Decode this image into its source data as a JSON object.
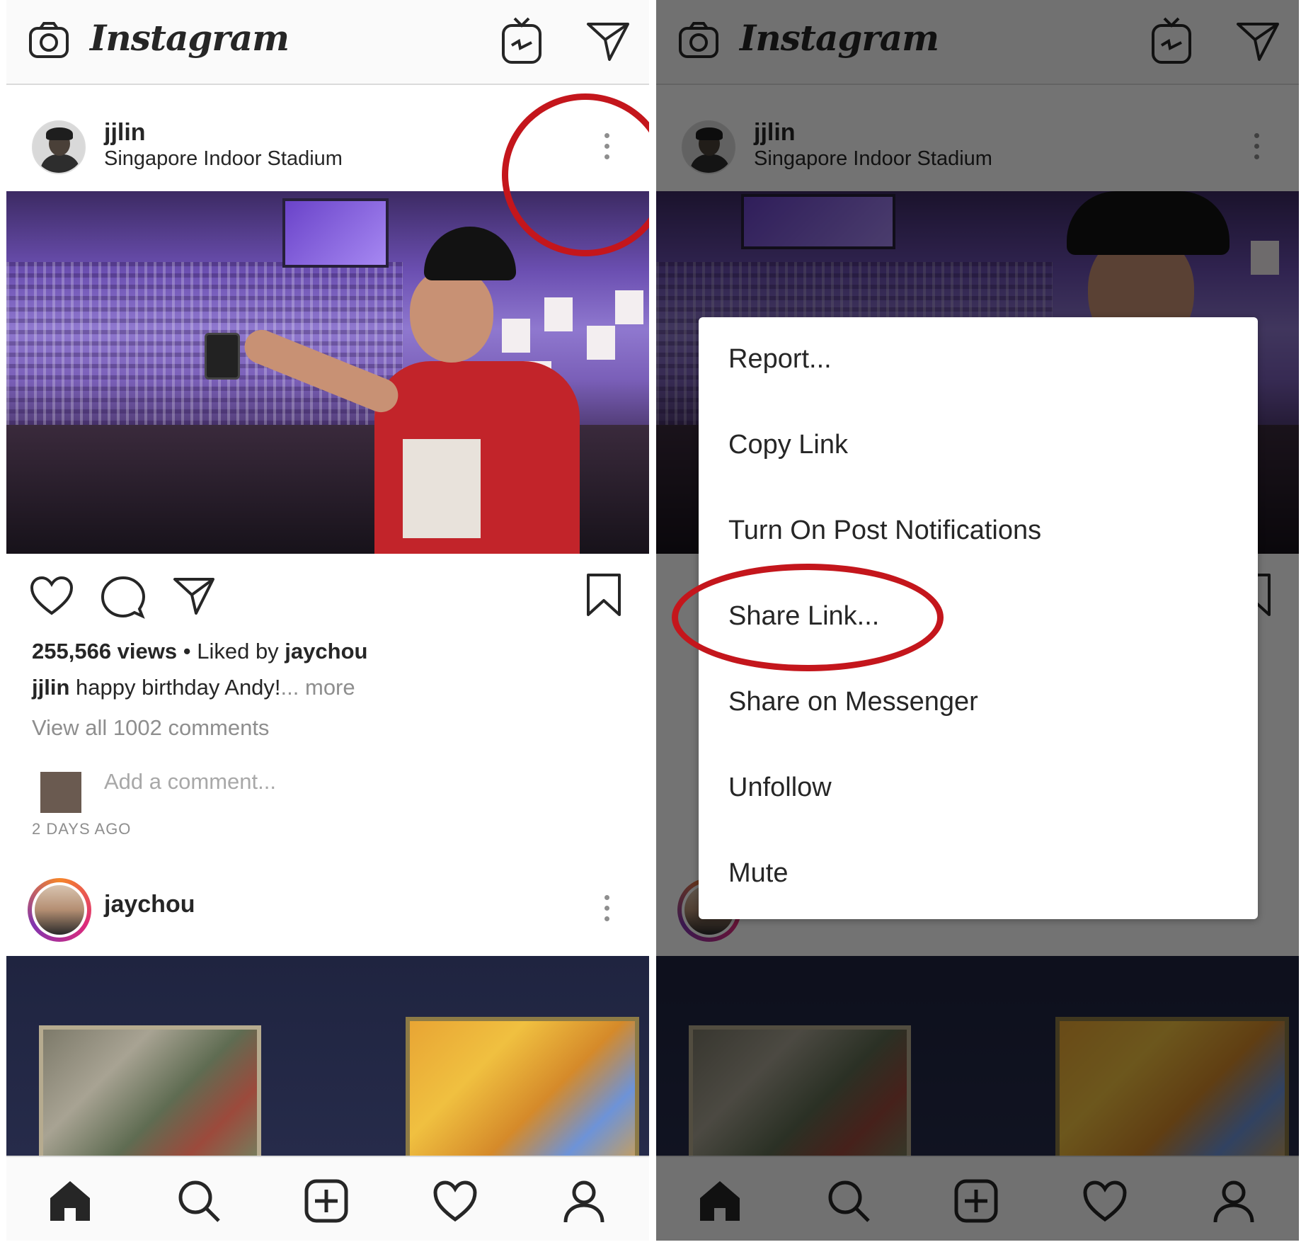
{
  "app": {
    "logo": "Instagram"
  },
  "icons": {
    "camera": "camera-icon",
    "igtv": "igtv-icon",
    "direct": "paper-plane-icon",
    "more": "more-vertical-icon",
    "like": "heart-icon",
    "comment": "comment-icon",
    "share": "paper-plane-icon",
    "save": "bookmark-icon",
    "home": "home-icon",
    "search": "search-icon",
    "add": "add-post-icon",
    "activity": "heart-icon",
    "profile": "profile-icon"
  },
  "colors": {
    "annotation_ring": "#c4161c",
    "text": "#262626",
    "secondary": "#8e8e8e"
  },
  "post": {
    "username": "jjlin",
    "location": "Singapore Indoor Stadium",
    "views": "255,566 views",
    "separator": " • ",
    "liked_by_prefix": "Liked by ",
    "liked_by_user": "jaychou",
    "caption_user": "jjlin",
    "caption_text": " happy birthday Andy!",
    "caption_more": "... more",
    "view_comments": "View all 1002 comments",
    "comment_placeholder": "Add a comment...",
    "timestamp": "2 DAYS AGO"
  },
  "next_post": {
    "username": "jaychou"
  },
  "menu": {
    "items": [
      "Report...",
      "Copy Link",
      "Turn On Post Notifications",
      "Share Link...",
      "Share on Messenger",
      "Unfollow",
      "Mute"
    ],
    "highlighted": "Share Link..."
  }
}
